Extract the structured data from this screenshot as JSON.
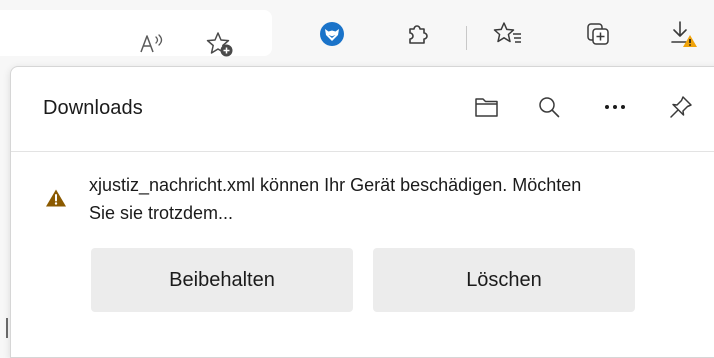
{
  "toolbar": {
    "icons": [
      "read-aloud-icon",
      "add-favorite-icon",
      "extension-fox-icon",
      "extensions-icon",
      "favorites-icon",
      "collections-icon",
      "downloads-icon"
    ],
    "accent_blue": "#1a73c9",
    "warning_color": "#f0a30a"
  },
  "downloads_panel": {
    "title": "Downloads",
    "header_icons": [
      "open-folder-icon",
      "search-icon",
      "more-options-icon",
      "pin-icon"
    ],
    "item": {
      "warning_text": "xjustiz_nachricht.xml können Ihr Gerät beschädigen. Möchten Sie sie trotzdem...",
      "keep_label": "Beibehalten",
      "delete_label": "Löschen",
      "warning_icon_color": "#8b5a00"
    }
  }
}
